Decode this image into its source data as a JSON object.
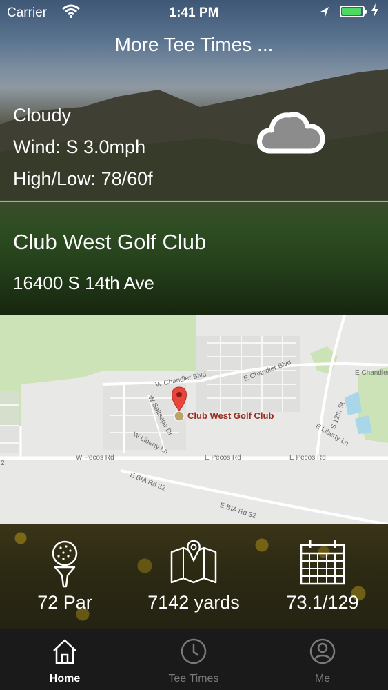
{
  "status_bar": {
    "carrier": "Carrier",
    "time": "1:41 PM",
    "battery_level": 0.9
  },
  "header": {
    "more_tee_times": "More Tee Times ..."
  },
  "weather": {
    "condition": "Cloudy",
    "wind": "Wind: S 3.0mph",
    "high_low": "High/Low: 78/60f",
    "icon": "cloud-icon"
  },
  "club": {
    "name": "Club West Golf Club",
    "address": "16400 S 14th Ave"
  },
  "map": {
    "place_label": "Club West Golf Club",
    "streets": [
      "W Chandler Blvd",
      "E Chandler Blvd",
      "E Chandler",
      "W Saltsage Dr",
      "W Liberty Ln",
      "E Liberty Ln",
      "S 12th St",
      "W Pecos Rd",
      "E Pecos Rd",
      "E Pecos Rd",
      "E BIA Rd 32",
      "E BIA Rd 32",
      "2"
    ]
  },
  "stats": [
    {
      "icon": "golf-ball-on-tee-icon",
      "label": "72 Par"
    },
    {
      "icon": "map-pin-icon",
      "label": "7142 yards"
    },
    {
      "icon": "calendar-icon",
      "label": "73.1/129"
    }
  ],
  "tabs": [
    {
      "icon": "home-icon",
      "label": "Home",
      "active": true
    },
    {
      "icon": "clock-icon",
      "label": "Tee Times",
      "active": false
    },
    {
      "icon": "user-icon",
      "label": "Me",
      "active": false
    }
  ],
  "colors": {
    "map_pin": "#e8453c",
    "place_label": "#9a2a1f",
    "battery": "#4cd964",
    "tab_active": "#ffffff",
    "tab_inactive": "#7a7a7a"
  }
}
